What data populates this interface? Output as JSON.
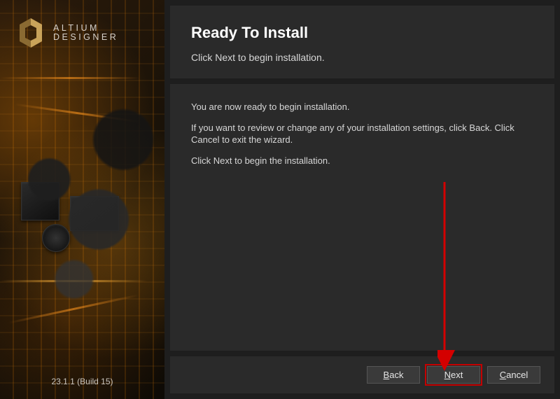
{
  "brand": {
    "line1": "ALTIUM",
    "line2": "DESIGNER"
  },
  "version": "23.1.1 (Build 15)",
  "header": {
    "title": "Ready To Install",
    "subtitle": "Click Next to begin installation."
  },
  "body": {
    "p1": "You are now ready to begin installation.",
    "p2": "If you want to review or change any of your installation settings, click Back. Click Cancel to exit the wizard.",
    "p3": "Click Next to begin the installation."
  },
  "buttons": {
    "back": "Back",
    "next": "Next",
    "cancel": "Cancel"
  },
  "colors": {
    "accent": "#c9a35a",
    "highlight": "#c40000"
  }
}
